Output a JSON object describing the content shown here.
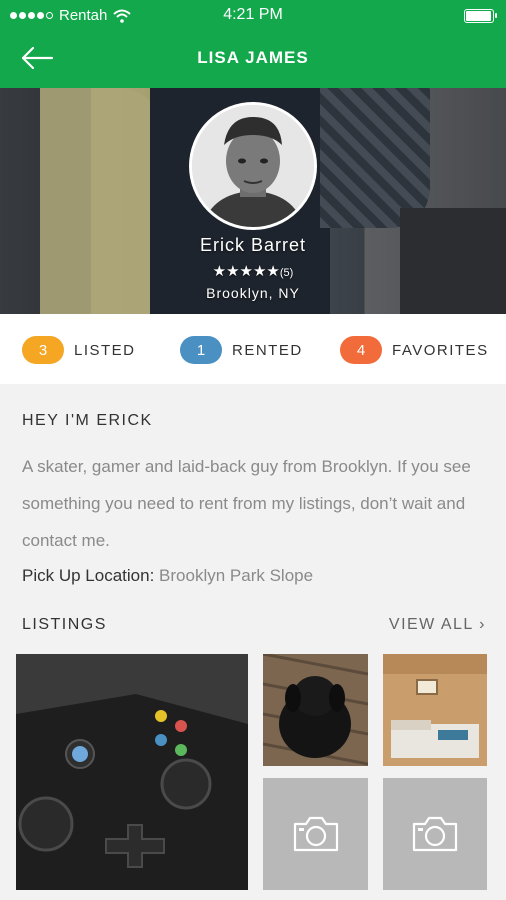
{
  "status": {
    "carrier": "Rentah",
    "time": "4:21 PM"
  },
  "nav": {
    "title": "LISA JAMES",
    "back_icon": "arrow-left-icon"
  },
  "profile": {
    "name": "Erick Barret",
    "stars": "★★★★★",
    "rating_count": "(5)",
    "location": "Brooklyn, NY"
  },
  "stats": [
    {
      "count": "3",
      "label": "LISTED",
      "color": "#f5a623"
    },
    {
      "count": "1",
      "label": "RENTED",
      "color": "#4a90c2"
    },
    {
      "count": "4",
      "label": "FAVORITES",
      "color": "#f26b3a"
    }
  ],
  "about": {
    "heading": "HEY I'M ERICK",
    "bio": "A skater, gamer and laid-back guy from Brooklyn. If you see something you need to rent from my listings, don’t wait and contact me.",
    "pickup_label": "Pick Up Location:",
    "pickup_value": "Brooklyn Park Slope"
  },
  "listings": {
    "heading": "LISTINGS",
    "view_all": "VIEW ALL ›"
  },
  "colors": {
    "brand": "#12a84b"
  }
}
